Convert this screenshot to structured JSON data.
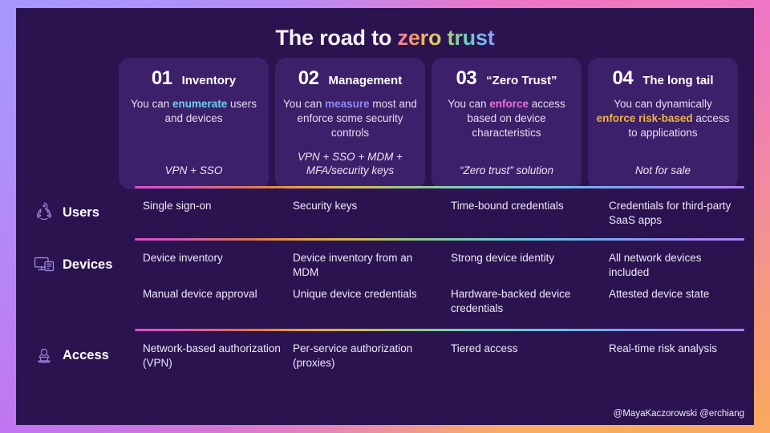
{
  "title": {
    "plain": "The road to ",
    "gradient": "zero trust"
  },
  "cards": [
    {
      "number": "01",
      "title": "Inventory",
      "desc_pre": "You can ",
      "desc_hl": "enumerate",
      "desc_post": " users and devices",
      "hl_color": "#6FD3EE",
      "footer": "VPN + SSO"
    },
    {
      "number": "02",
      "title": "Management",
      "desc_pre": "You can ",
      "desc_hl": "measure",
      "desc_post": " most and enforce some security controls",
      "hl_color": "#8E8BF5",
      "footer": "VPN + SSO + MDM + MFA/security keys"
    },
    {
      "number": "03",
      "title": "“Zero Trust”",
      "desc_pre": "You can ",
      "desc_hl": "enforce",
      "desc_post": " access based on device characteristics",
      "hl_color": "#EC72D8",
      "footer": "“Zero trust” solution"
    },
    {
      "number": "04",
      "title": "The long tail",
      "desc_pre": "You can dynamically ",
      "desc_hl": "enforce risk-based",
      "desc_post": " access to applications",
      "hl_color": "#F0B33F",
      "footer": "Not for sale"
    }
  ],
  "rows": [
    {
      "label": "Users",
      "icon": "users-network-icon",
      "lines": [
        [
          "Single sign-on",
          "Security keys",
          "Time-bound credentials",
          "Credentials for third-party SaaS apps"
        ]
      ]
    },
    {
      "label": "Devices",
      "icon": "devices-monitor-icon",
      "lines": [
        [
          "Device inventory",
          "Device inventory from an MDM",
          "Strong device identity",
          "All network devices included"
        ],
        [
          "Manual device approval",
          "Unique device credentials",
          "Hardware-backed device credentials",
          "Attested device state"
        ]
      ]
    },
    {
      "label": "Access",
      "icon": "person-laptop-icon",
      "lines": [
        [
          "Network-based authorization (VPN)",
          "Per-service authorization (proxies)",
          "Tiered access",
          "Real-time risk analysis"
        ]
      ]
    }
  ],
  "credits": "@MayaKaczorowski @erchiang",
  "colors": {
    "slide_bg": "#2B1350",
    "card_bg": "#3C2069",
    "icon_stroke": "#A493E8"
  }
}
